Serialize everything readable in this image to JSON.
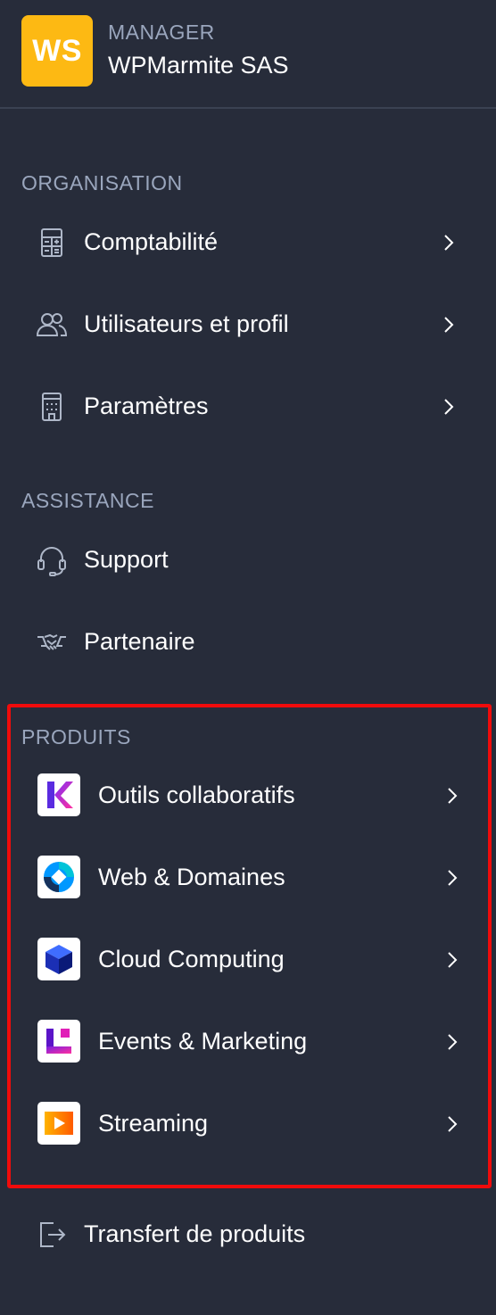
{
  "header": {
    "avatar_initials": "WS",
    "avatar_color": "#fdb913",
    "role": "MANAGER",
    "company": "WPMarmite SAS"
  },
  "sections": {
    "organisation": {
      "title": "ORGANISATION",
      "items": [
        {
          "label": "Comptabilité",
          "icon": "calculator-icon"
        },
        {
          "label": "Utilisateurs et profil",
          "icon": "users-icon"
        },
        {
          "label": "Paramètres",
          "icon": "building-icon"
        }
      ]
    },
    "assistance": {
      "title": "ASSISTANCE",
      "items": [
        {
          "label": "Support",
          "icon": "headset-icon"
        },
        {
          "label": "Partenaire",
          "icon": "handshake-icon"
        }
      ]
    },
    "produits": {
      "title": "PRODUITS",
      "items": [
        {
          "label": "Outils collaboratifs",
          "icon": "kdrive-logo-icon"
        },
        {
          "label": "Web & Domaines",
          "icon": "web-logo-icon"
        },
        {
          "label": "Cloud Computing",
          "icon": "cloud-cube-logo-icon"
        },
        {
          "label": "Events & Marketing",
          "icon": "events-logo-icon"
        },
        {
          "label": "Streaming",
          "icon": "streaming-play-logo-icon"
        }
      ]
    }
  },
  "footer": {
    "transfer_label": "Transfert de produits",
    "transfer_icon": "exit-icon"
  },
  "colors": {
    "background": "#272c3a",
    "section_title": "#9aa6bd",
    "highlight_border": "#f00b0b"
  }
}
